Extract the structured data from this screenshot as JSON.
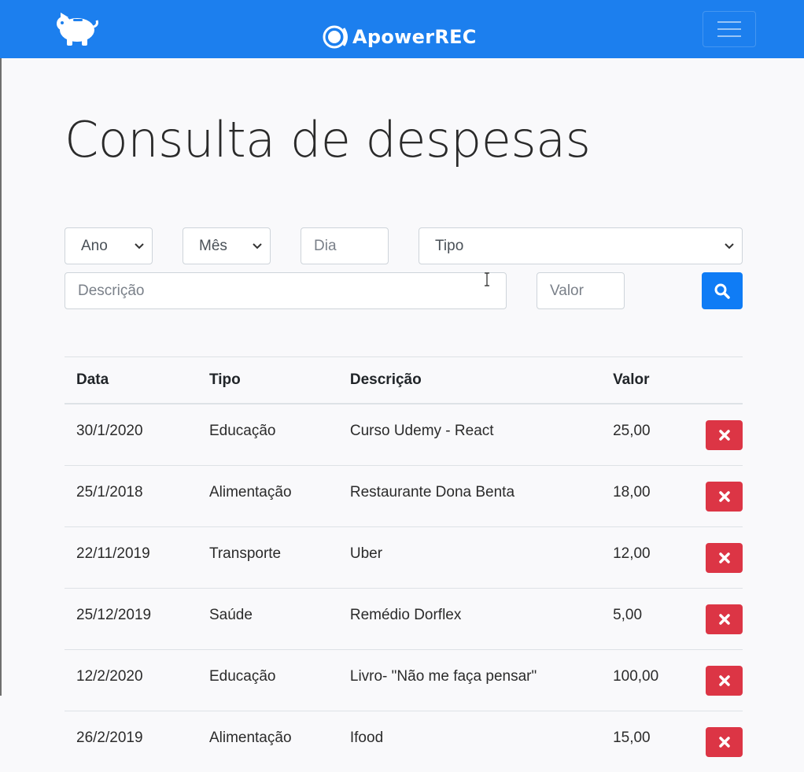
{
  "navbar": {
    "logo_icon": "piggy-bank-icon",
    "watermark": "ApowerREC",
    "menu_icon": "hamburger-menu-icon",
    "color": "#1c7fee"
  },
  "page": {
    "title": "Consulta de despesas"
  },
  "filters": {
    "ano": "Ano",
    "mes": "Mês",
    "dia_placeholder": "Dia",
    "tipo": "Tipo",
    "descricao_placeholder": "Descrição",
    "valor_placeholder": "Valor",
    "search_icon": "search-icon"
  },
  "table": {
    "headers": [
      "Data",
      "Tipo",
      "Descrição",
      "Valor"
    ],
    "rows": [
      {
        "data": "30/1/2020",
        "tipo": "Educação",
        "descricao": "Curso Udemy - React",
        "valor": "25,00"
      },
      {
        "data": "25/1/2018",
        "tipo": "Alimentação",
        "descricao": "Restaurante Dona Benta",
        "valor": "18,00"
      },
      {
        "data": "22/11/2019",
        "tipo": "Transporte",
        "descricao": "Uber",
        "valor": "12,00"
      },
      {
        "data": "25/12/2019",
        "tipo": "Saúde",
        "descricao": "Remédio Dorflex",
        "valor": "5,00"
      },
      {
        "data": "12/2/2020",
        "tipo": "Educação",
        "descricao": "Livro- \"Não me faça pensar\"",
        "valor": "100,00"
      },
      {
        "data": "26/2/2019",
        "tipo": "Alimentação",
        "descricao": "Ifood",
        "valor": "15,00"
      }
    ],
    "delete_icon": "close-icon",
    "delete_color": "#dc3545"
  }
}
